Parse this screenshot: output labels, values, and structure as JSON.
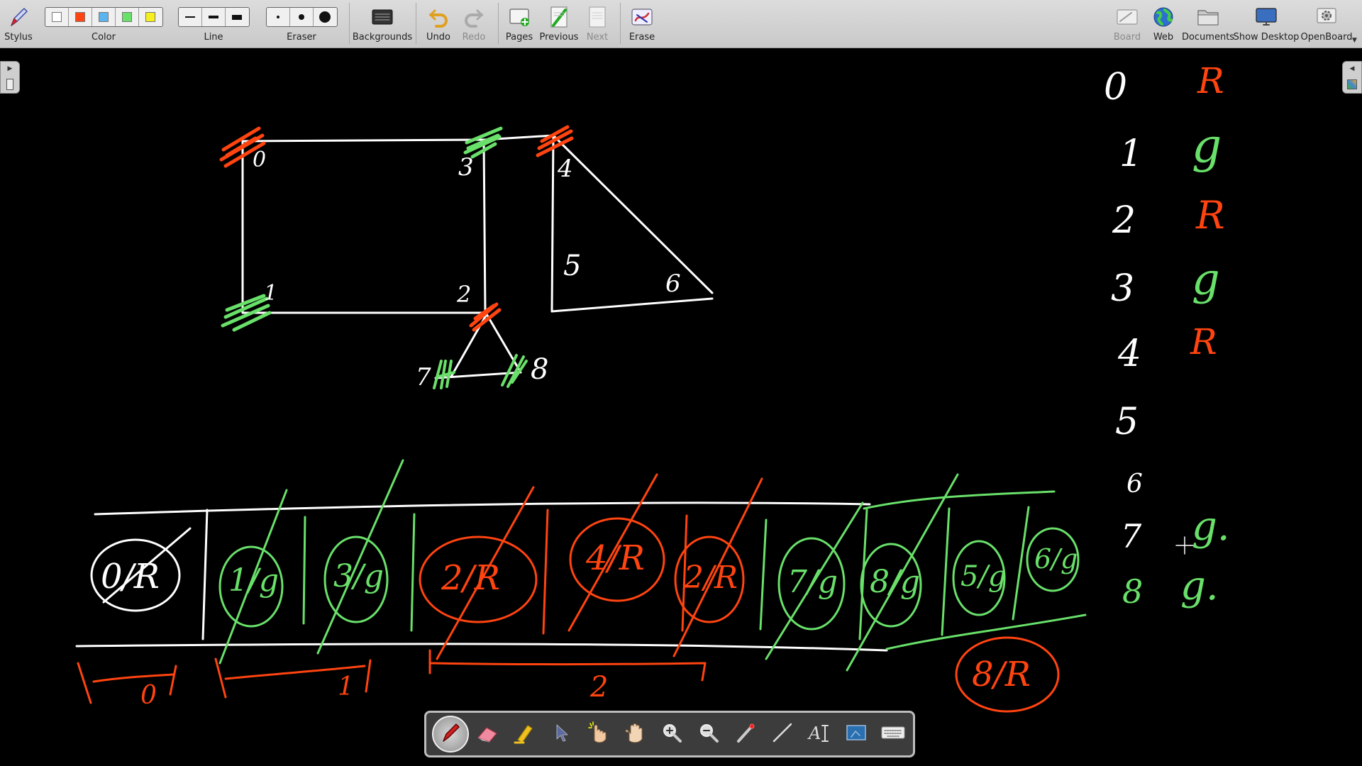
{
  "toolbar": {
    "stylus": "Stylus",
    "color": "Color",
    "line": "Line",
    "eraser": "Eraser",
    "backgrounds": "Backgrounds",
    "undo": "Undo",
    "redo": "Redo",
    "pages": "Pages",
    "previous": "Previous",
    "next": "Next",
    "erase": "Erase",
    "board": "Board",
    "web": "Web",
    "documents": "Documents",
    "show_desktop": "Show Desktop",
    "openboard": "OpenBoard"
  },
  "colors": {
    "white": "#ffffff",
    "red": "#ff4410",
    "blue": "#5ab4f0",
    "green": "#69e06a",
    "yellow": "#f5ef1e"
  },
  "palette_tools": [
    "pen-icon",
    "eraser-icon",
    "marker-icon",
    "selector-icon",
    "interact-icon",
    "hand-icon",
    "zoom-in-icon",
    "zoom-out-icon",
    "laser-pointer-icon",
    "line-icon",
    "text-icon",
    "capture-icon",
    "keyboard-icon"
  ],
  "board": {
    "graph_labels": [
      "0",
      "1",
      "2",
      "3",
      "4",
      "5",
      "6",
      "7",
      "8"
    ],
    "right_column_numbers": [
      "0",
      "1",
      "2",
      "3",
      "4",
      "5",
      "6",
      "7",
      "8"
    ],
    "right_column_colors": [
      "R",
      "g",
      "R",
      "g",
      "R",
      "",
      "",
      "g.",
      "g."
    ],
    "cells": [
      "0/R",
      "1/g",
      "3/g",
      "2/R",
      "4/R",
      "2/R",
      "7/g",
      "8/g",
      "5/g",
      "6/g"
    ],
    "extra_cell": "8/R",
    "brace_labels": [
      "0",
      "1",
      "2"
    ]
  }
}
